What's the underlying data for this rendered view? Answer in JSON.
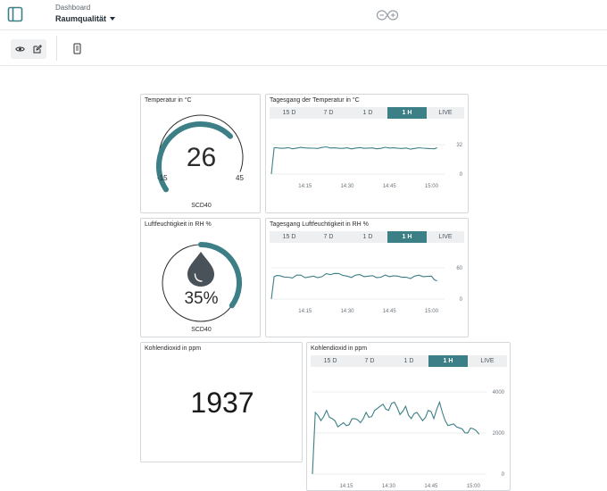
{
  "header": {
    "breadcrumb": "Dashboard",
    "title": "Raumqualität"
  },
  "widgets": {
    "temp_gauge": {
      "title": "Temperatur in °C",
      "value": "26",
      "min": "-15",
      "max": "45",
      "level": 0.68,
      "sensor": "SCD40"
    },
    "hum_gauge": {
      "title": "Luftfeuchtigkeit in RH %",
      "value": "35%",
      "level": 0.35,
      "sensor": "SCD40"
    },
    "co2_value": {
      "title": "Kohlendioxid in ppm",
      "value": "1937"
    },
    "temp_chart": {
      "title": "Tagesgang der Temperatur in °C"
    },
    "hum_chart": {
      "title": "Tagesgang Luftfeuchtigkeit in RH %"
    },
    "co2_chart": {
      "title": "Kohlendioxid in ppm"
    }
  },
  "range_tabs": [
    "15 D",
    "7 D",
    "1 D",
    "1 H",
    "LIVE"
  ],
  "active_tab": "1 H",
  "colors": {
    "accent": "#3d7f87",
    "gauge_track": "#cfd3d6",
    "drop": "#4a5259"
  },
  "icons": [
    "sidebar-toggle-icon",
    "arduino-logo-icon",
    "eye-icon",
    "edit-icon",
    "phone-icon",
    "water-drop-icon"
  ],
  "chart_data": [
    {
      "type": "line",
      "title": "Tagesgang der Temperatur in °C",
      "xlabel": "",
      "ylabel": "",
      "x_ticks": [
        "14:15",
        "14:30",
        "14:45",
        "15:00"
      ],
      "y_ticks": [
        0,
        32
      ],
      "ylim": [
        0,
        32
      ],
      "x": [
        "14:03",
        "14:04",
        "14:06",
        "14:09",
        "14:12",
        "14:15",
        "14:18",
        "14:21",
        "14:24",
        "14:27",
        "14:30",
        "14:33",
        "14:36",
        "14:39",
        "14:42",
        "14:45",
        "14:48",
        "14:51",
        "14:54",
        "14:57",
        "15:00",
        "15:02"
      ],
      "values": [
        0,
        28.5,
        28.0,
        28.7,
        28.2,
        28.4,
        28.1,
        28.9,
        28.3,
        28.0,
        28.5,
        28.2,
        28.0,
        28.4,
        27.9,
        28.3,
        28.0,
        28.3,
        27.8,
        28.1,
        27.6,
        28.6
      ]
    },
    {
      "type": "line",
      "title": "Tagesgang Luftfeuchtigkeit in RH %",
      "xlabel": "",
      "ylabel": "",
      "x_ticks": [
        "14:15",
        "14:30",
        "14:45",
        "15:00"
      ],
      "y_ticks": [
        0,
        60
      ],
      "ylim": [
        0,
        60
      ],
      "x": [
        "14:03",
        "14:04",
        "14:06",
        "14:09",
        "14:12",
        "14:15",
        "14:18",
        "14:21",
        "14:24",
        "14:27",
        "14:30",
        "14:33",
        "14:36",
        "14:39",
        "14:42",
        "14:45",
        "14:48",
        "14:51",
        "14:54",
        "14:57",
        "15:00",
        "15:02"
      ],
      "values": [
        0,
        43,
        45,
        42,
        46,
        41,
        44,
        43,
        47,
        49,
        44,
        46,
        43,
        45,
        42,
        43,
        44,
        42,
        44,
        43,
        44,
        35
      ]
    },
    {
      "type": "line",
      "title": "Kohlendioxid in ppm",
      "xlabel": "",
      "ylabel": "",
      "x_ticks": [
        "14:15",
        "14:30",
        "14:45",
        "15:00"
      ],
      "y_ticks": [
        0,
        2000,
        4000
      ],
      "ylim": [
        0,
        4000
      ],
      "x": [
        "14:03",
        "14:04",
        "14:06",
        "14:08",
        "14:10",
        "14:12",
        "14:14",
        "14:16",
        "14:18",
        "14:20",
        "14:22",
        "14:24",
        "14:26",
        "14:28",
        "14:30",
        "14:32",
        "14:34",
        "14:36",
        "14:38",
        "14:40",
        "14:42",
        "14:44",
        "14:46",
        "14:48",
        "14:50",
        "14:52",
        "14:54",
        "14:56",
        "14:58",
        "15:00",
        "15:02"
      ],
      "values": [
        0,
        3000,
        2600,
        3100,
        2700,
        2300,
        2500,
        2400,
        2700,
        2500,
        3000,
        2800,
        3200,
        3400,
        3100,
        3500,
        2900,
        3300,
        2700,
        3000,
        2600,
        3100,
        2700,
        3500,
        2600,
        2400,
        2300,
        2200,
        2000,
        2200,
        1937
      ]
    }
  ]
}
